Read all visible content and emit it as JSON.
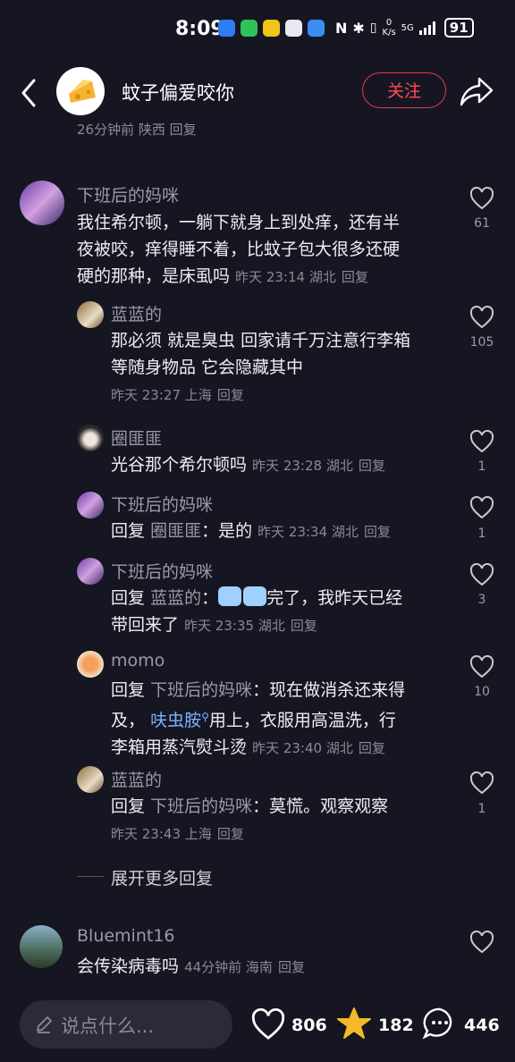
{
  "status_bar": {
    "time": "8:09",
    "battery": "91",
    "net_speed_top": "0",
    "net_speed_bottom": "K/s",
    "signal": "5G"
  },
  "header": {
    "title": "蚊子偏爱咬你",
    "follow_label": "关注"
  },
  "partial_meta": "26分钟前 陕西 回复",
  "comments": [
    {
      "name": "下班后的妈咪",
      "text_lines": [
        "我住希尔顿，一躺下就身上到处痒，还有半",
        "夜被咬，痒得睡不着，比蚊子包大很多还硬",
        "硬的那种，是床虱吗"
      ],
      "meta": "昨天 23:14 湖北",
      "reply": "回复",
      "likes": "61"
    },
    {
      "name": "蓝蓝的",
      "text_lines": [
        "那必须 就是臭虫 回家请千万注意行李箱",
        "等随身物品 它会隐藏其中"
      ],
      "meta": "昨天 23:27 上海",
      "reply": "回复",
      "likes": "105"
    },
    {
      "name": "圈匪匪",
      "text": "光谷那个希尔顿吗",
      "meta": "昨天 23:28 湖北",
      "reply": "回复",
      "likes": "1"
    },
    {
      "name": "下班后的妈咪",
      "reply_prefix": "回复",
      "reply_to": "圈匪匪",
      "text": "：是的",
      "meta": "昨天 23:34 湖北",
      "reply": "回复",
      "likes": "1"
    },
    {
      "name": "下班后的妈咪",
      "reply_prefix": "回复",
      "reply_to": "蓝蓝的",
      "text": "：",
      "text2": "完了，我昨天已经",
      "text3": "带回来了",
      "meta": "昨天 23:35 湖北",
      "reply": "回复",
      "likes": "3"
    },
    {
      "name": "momo",
      "reply_prefix": "回复",
      "reply_to": "下班后的妈咪",
      "text": "：现在做消杀还来得",
      "line2_a": "及，",
      "highlight": "呋虫胺",
      "line2_b": "用上，衣服用高温洗，行",
      "line3": "李箱用蒸汽熨斗烫",
      "meta": "昨天 23:40 湖北",
      "reply": "回复",
      "likes": "10"
    },
    {
      "name": "蓝蓝的",
      "reply_prefix": "回复",
      "reply_to": "下班后的妈咪",
      "text": "：莫慌。观察观察",
      "meta": "昨天 23:43 上海",
      "reply": "回复",
      "likes": "1"
    },
    {
      "name": "Bluemint16",
      "text": "会传染病毒吗",
      "meta": "44分钟前 海南",
      "reply": "回复",
      "likes": ""
    }
  ],
  "expand_label": "展开更多回复",
  "bottom": {
    "input_placeholder": "说点什么...",
    "likes": "806",
    "stars": "182",
    "comments": "446"
  },
  "colors": {
    "background": "#161622",
    "accent_red": "#e03a4a",
    "highlight_blue": "#7fb2ff",
    "star_gold": "#f5b829"
  }
}
